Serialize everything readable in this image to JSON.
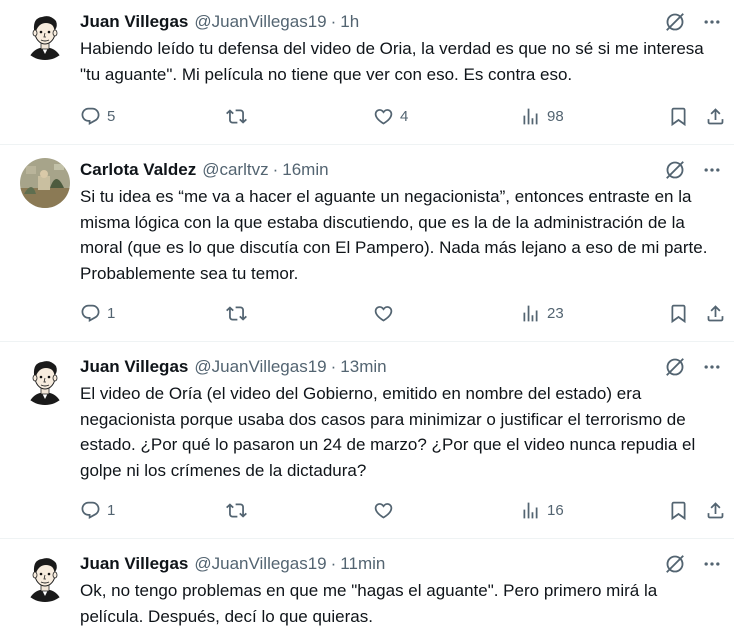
{
  "tweets": [
    {
      "name": "Juan Villegas",
      "handle": "@JuanVillegas19",
      "separator": "·",
      "time": "1h",
      "text": "Habiendo leído tu defensa del video de Oria, la verdad es que no sé si me interesa \"tu aguante\". Mi película no tiene que ver con eso. Es contra eso.",
      "replies": "5",
      "retweets": "",
      "likes": "4",
      "views": "98"
    },
    {
      "name": "Carlota Valdez",
      "handle": "@carltvz",
      "separator": "·",
      "time": "16min",
      "text": "Si tu idea es “me va a hacer el aguante un negacionista”, entonces entraste en la misma lógica con la que estaba discutiendo, que es la de la administración de la moral (que es lo que discutía con El Pampero). Nada más lejano a eso de mi parte. Probablemente sea tu temor.",
      "replies": "1",
      "retweets": "",
      "likes": "",
      "views": "23"
    },
    {
      "name": "Juan Villegas",
      "handle": "@JuanVillegas19",
      "separator": "·",
      "time": "13min",
      "text": "El video de Oría (el video del Gobierno, emitido en nombre del estado) era negacionista porque usaba dos casos para minimizar o justificar el terrorismo de estado. ¿Por qué lo pasaron un 24 de marzo? ¿Por que el video nunca repudia el golpe ni los crímenes de la dictadura?",
      "replies": "1",
      "retweets": "",
      "likes": "",
      "views": "16"
    },
    {
      "name": "Juan Villegas",
      "handle": "@JuanVillegas19",
      "separator": "·",
      "time": "11min",
      "text": "Ok, no tengo problemas en que me \"hagas el aguante\". Pero primero mirá la película. Después, decí lo que quieras.",
      "replies": "",
      "retweets": "",
      "likes": "",
      "views": ""
    }
  ],
  "icons": {
    "reply": "reply-icon",
    "retweet": "retweet-icon",
    "like": "heart-icon",
    "views": "views-icon",
    "bookmark": "bookmark-icon",
    "share": "share-icon",
    "grok": "grok-icon",
    "more": "more-icon"
  },
  "colors": {
    "text": "#0f1419",
    "secondary": "#536471",
    "divider": "#eff3f4"
  }
}
